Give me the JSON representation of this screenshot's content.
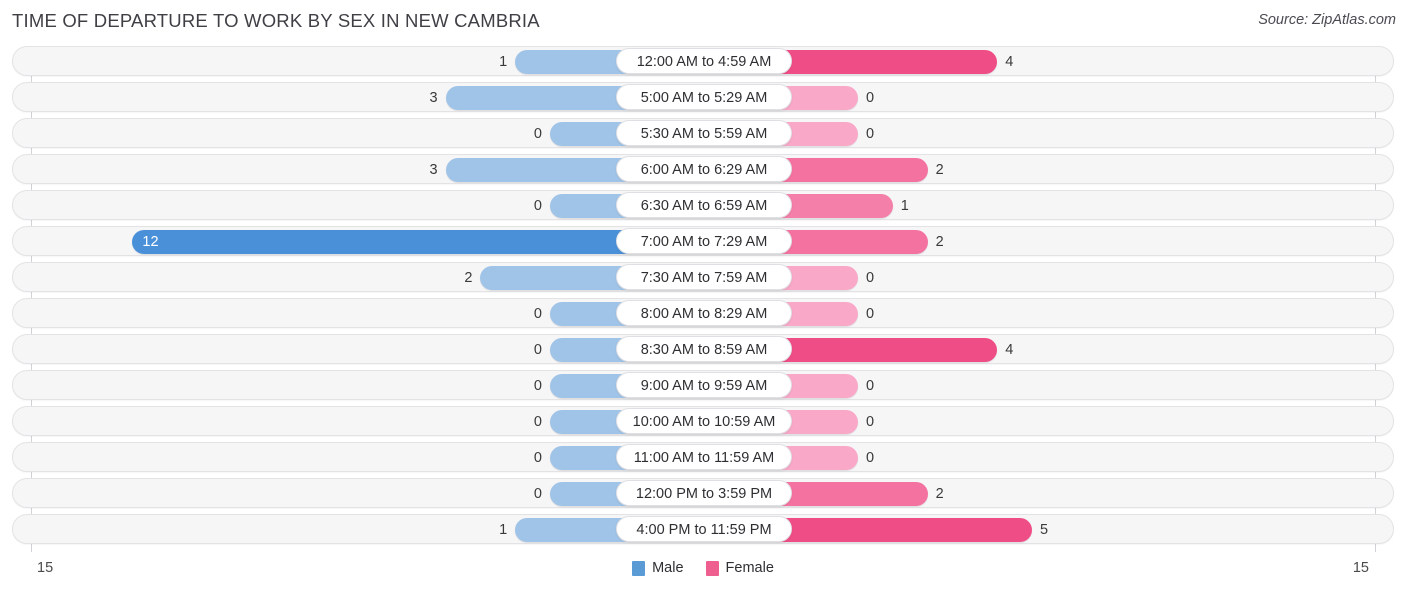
{
  "header": {
    "title": "TIME OF DEPARTURE TO WORK BY SEX IN NEW CAMBRIA",
    "source": "Source: ZipAtlas.com"
  },
  "legend": {
    "male_label": "Male",
    "female_label": "Female",
    "male_color": "#5b9bd5",
    "female_color": "#ee5f8f"
  },
  "axis": {
    "left_max": "15",
    "right_max": "15"
  },
  "chart_data": {
    "type": "bar",
    "orientation": "horizontal-diverging",
    "title": "TIME OF DEPARTURE TO WORK BY SEX IN NEW CAMBRIA",
    "xlabel": "",
    "ylabel": "",
    "xlim": [
      15,
      15
    ],
    "grid": false,
    "legend_position": "bottom-center",
    "categories": [
      "12:00 AM to 4:59 AM",
      "5:00 AM to 5:29 AM",
      "5:30 AM to 5:59 AM",
      "6:00 AM to 6:29 AM",
      "6:30 AM to 6:59 AM",
      "7:00 AM to 7:29 AM",
      "7:30 AM to 7:59 AM",
      "8:00 AM to 8:29 AM",
      "8:30 AM to 8:59 AM",
      "9:00 AM to 9:59 AM",
      "10:00 AM to 10:59 AM",
      "11:00 AM to 11:59 AM",
      "12:00 PM to 3:59 PM",
      "4:00 PM to 11:59 PM"
    ],
    "series": [
      {
        "name": "Male",
        "color": "#5b9bd5",
        "values": [
          1,
          3,
          0,
          3,
          0,
          12,
          2,
          0,
          0,
          0,
          0,
          0,
          0,
          1
        ]
      },
      {
        "name": "Female",
        "color": "#ee5f8f",
        "values": [
          4,
          0,
          0,
          2,
          1,
          2,
          0,
          0,
          4,
          0,
          0,
          0,
          2,
          5
        ]
      }
    ]
  }
}
